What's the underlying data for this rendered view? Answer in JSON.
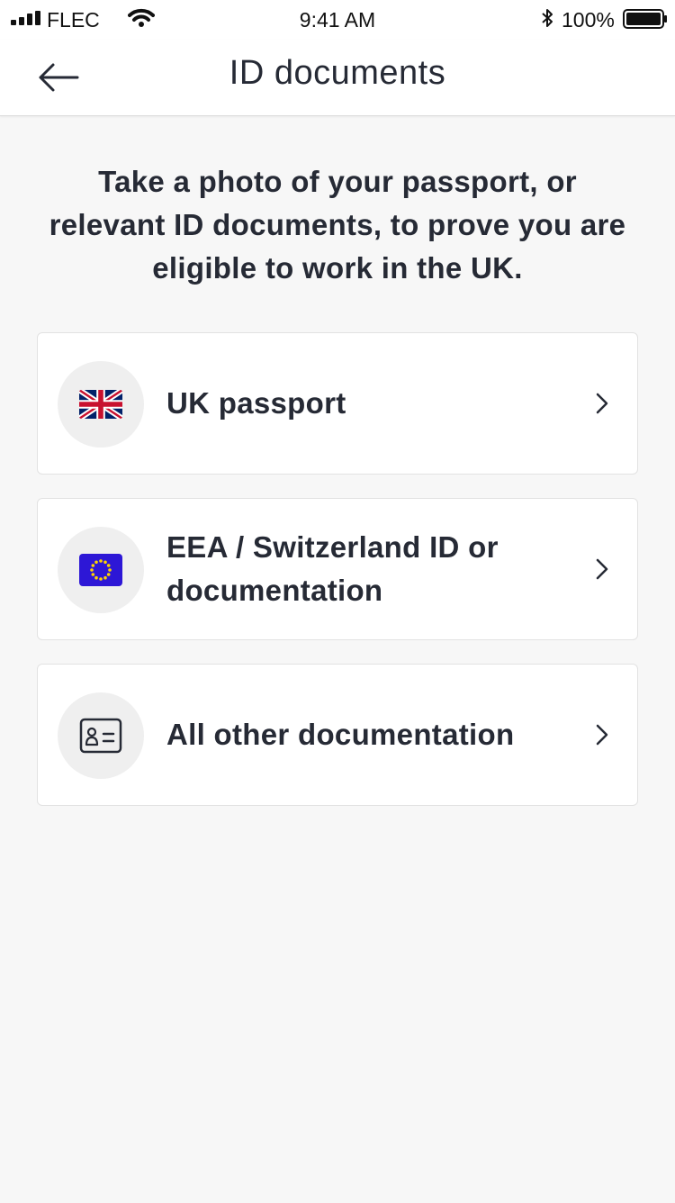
{
  "status_bar": {
    "carrier": "FLEC",
    "time": "9:41 AM",
    "battery": "100%"
  },
  "header": {
    "title": "ID documents",
    "back_icon": "arrow-left-icon"
  },
  "intro_text": "Take a photo of your passport, or relevant ID documents, to prove you are eligible to work in the UK.",
  "options": [
    {
      "label": "UK passport",
      "icon": "uk-flag-icon"
    },
    {
      "label": "EEA / Switzerland ID or documentation",
      "icon": "eu-flag-icon"
    },
    {
      "label": "All other documentation",
      "icon": "id-card-icon"
    }
  ],
  "colors": {
    "background": "#f7f7f7",
    "text": "#262a35",
    "eu_blue": "#2d17d6",
    "uk_red": "#c8102e",
    "uk_blue": "#012169"
  }
}
